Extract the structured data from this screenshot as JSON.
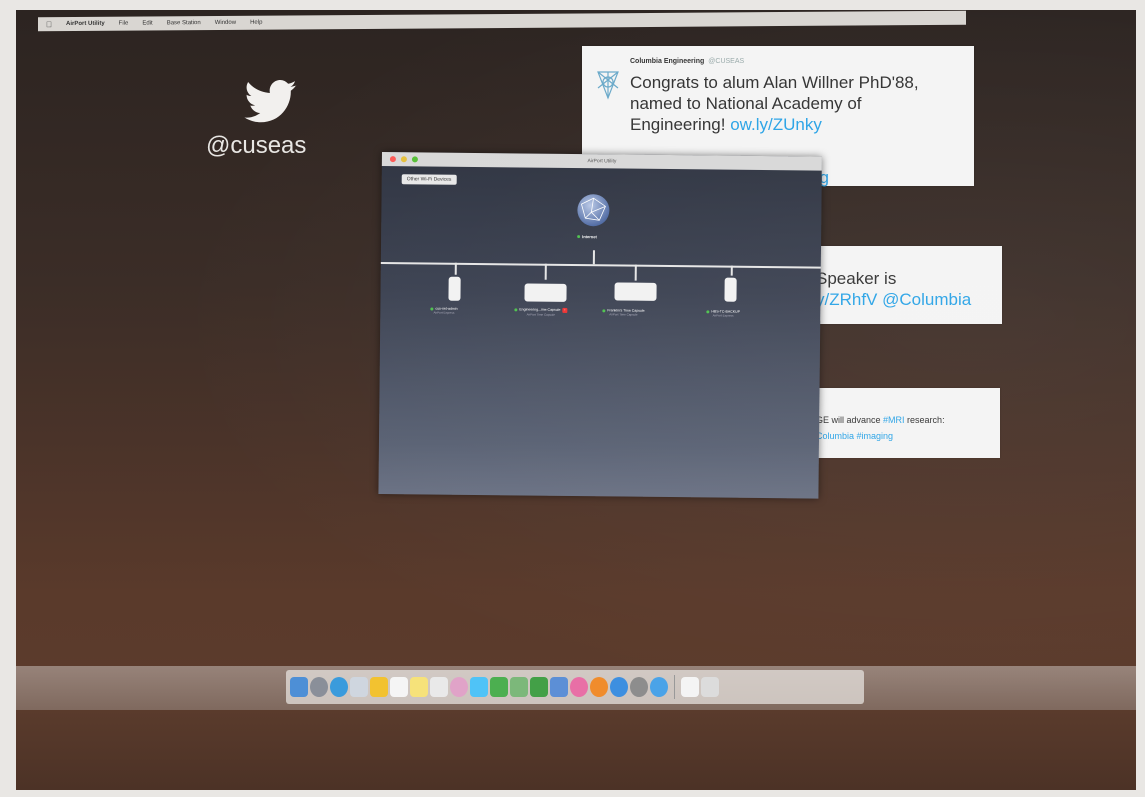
{
  "menubar": {
    "apple_icon": "apple-icon",
    "app_name": "AirPort Utility",
    "items": [
      "File",
      "Edit",
      "Base Station",
      "Window",
      "Help"
    ]
  },
  "profile": {
    "icon": "twitter-bird-icon",
    "handle": "@cuseas"
  },
  "tweets": [
    {
      "author": "Columbia Engineering",
      "handle": "@CUSEAS",
      "text": "Congrats to alum Alan Willner PhD'88, named to National Academy of Engineering!",
      "link": "ow.ly/ZUnky",
      "tail": "ng"
    },
    {
      "text_line1": "Speaker is",
      "link": "y/ZRhfV @Columbia"
    },
    {
      "text": "GE will advance ",
      "tag1": "#MRI",
      "text2": " research:",
      "tag2": "Columbia #imaging"
    }
  ],
  "window": {
    "title": "AirPort Utility",
    "other_devices_button": "Other Wi-Fi Devices",
    "internet_label": "Internet",
    "devices": [
      {
        "name": "cus-net-admin",
        "sub": "AirPort Express"
      },
      {
        "name": "Engineering...ime Capsule",
        "sub": "AirPort Time Capsule",
        "warning": "!"
      },
      {
        "name": "Franklin's Time Capsule",
        "sub": "AirPort Time Capsule"
      },
      {
        "name": "HBS-TC-BACKUP",
        "sub": "AirPort Express"
      }
    ]
  },
  "dock": {
    "icons": [
      "finder-icon",
      "launchpad-icon",
      "safari-icon",
      "mail-icon",
      "notes-icon",
      "calendar-icon",
      "stickies-icon",
      "preview-icon",
      "photos-icon",
      "messages-icon",
      "facetime-icon",
      "maps-icon",
      "numbers-icon",
      "keynote-icon",
      "itunes-icon",
      "ibooks-icon",
      "app-store-icon",
      "system-preferences-icon",
      "airport-utility-icon",
      "documents-icon",
      "trash-icon"
    ]
  }
}
